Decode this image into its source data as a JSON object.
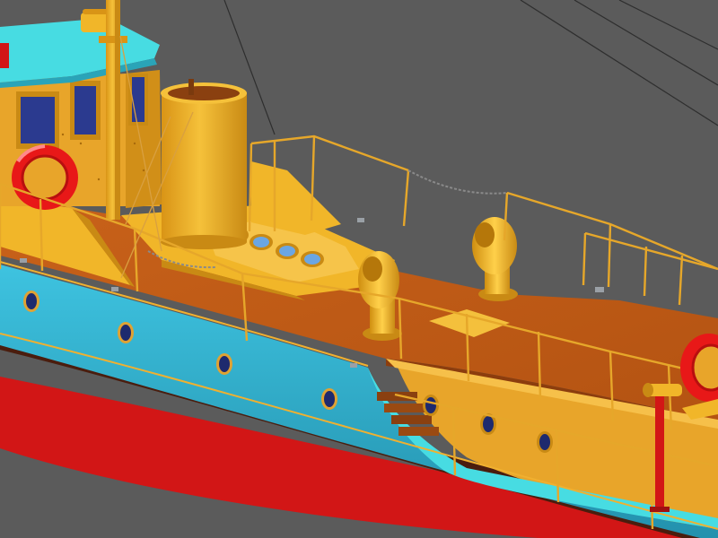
{
  "scene": {
    "subject": "ship-model-render",
    "colors": {
      "background": "#5b5b5b",
      "deck": "#c35c14",
      "deck_shadow": "#9f4a10",
      "superstructure": "#f1b629",
      "superstructure_dark": "#c98a14",
      "hull_upper": "#32b6d6",
      "hull_upper_dark": "#2391ad",
      "hull_lower": "#d21616",
      "hull_waterline": "#4a1d0e",
      "roof": "#47dce2",
      "lifebuoy": "#e81818",
      "porthole_glass": "#1e2a6e",
      "rail": "#e6a72a",
      "rope": "#8a8a8a"
    },
    "icons": [
      "lifebuoy-icon",
      "porthole-icon",
      "ventilator-icon",
      "funnel-icon",
      "mast-icon"
    ]
  }
}
